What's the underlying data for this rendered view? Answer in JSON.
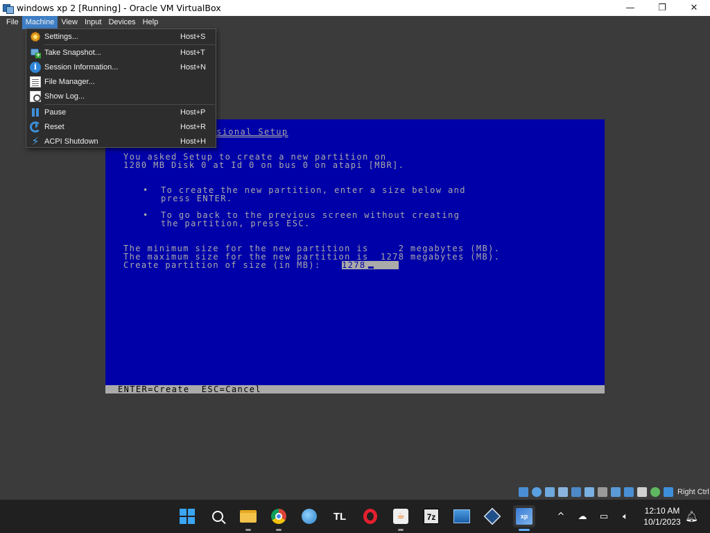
{
  "window": {
    "title": "windows xp 2 [Running] - Oracle VM VirtualBox",
    "minimize": "—",
    "maximize": "❐",
    "close": "✕"
  },
  "menubar": [
    "File",
    "Machine",
    "View",
    "Input",
    "Devices",
    "Help"
  ],
  "machine_menu": [
    {
      "label": "Settings...",
      "shortcut": "Host+S",
      "icon": "gear-icon"
    },
    {
      "label": "Take Snapshot...",
      "shortcut": "Host+T",
      "icon": "snapshot-icon"
    },
    {
      "label": "Session Information...",
      "shortcut": "Host+N",
      "icon": "info-icon"
    },
    {
      "label": "File Manager...",
      "shortcut": "",
      "icon": "file-manager-icon"
    },
    {
      "label": "Show Log...",
      "shortcut": "",
      "icon": "log-icon"
    },
    {
      "label": "Pause",
      "shortcut": "Host+P",
      "icon": "pause-icon"
    },
    {
      "label": "Reset",
      "shortcut": "Host+R",
      "icon": "reset-icon"
    },
    {
      "label": "ACPI Shutdown",
      "shortcut": "Host+H",
      "icon": "shutdown-icon"
    }
  ],
  "setup": {
    "header": "sional Setup",
    "line1": "You asked Setup to create a new partition on",
    "line2": "1280 MB Disk 0 at Id 0 on bus 0 on atapi [MBR].",
    "bullet1a": "To create the new partition, enter a size below and",
    "bullet1b": "press ENTER.",
    "bullet2a": "To go back to the previous screen without creating",
    "bullet2b": "the partition, press ESC.",
    "min_line": "The minimum size for the new partition is     2 megabytes (MB).",
    "max_line": "The maximum size for the new partition is  1278 megabytes (MB).",
    "prompt": "Create partition of size (in MB):",
    "size_value": "1278",
    "status": "ENTER=Create  ESC=Cancel"
  },
  "vbox_status": {
    "host_key": "Right Ctrl",
    "indicator_icons": [
      "hard-disk-icon",
      "optical-icon",
      "floppy-icon",
      "audio-icon",
      "network-icon",
      "usb-icon",
      "shared-folder-icon",
      "display-icon",
      "recording-icon",
      "cpu-icon",
      "mouse-icon",
      "keyboard-icon"
    ]
  },
  "taskbar": {
    "apps": [
      "start",
      "search",
      "file-explorer",
      "chrome",
      "browser",
      "TL",
      "opera",
      "java",
      "7z",
      "remote-desktop",
      "virtualbox",
      "virtualbox-vm"
    ],
    "tl_label": "TL",
    "sevenz_label": "7z",
    "vm_label": "xp",
    "time": "12:10 AM",
    "date": "10/1/2023"
  }
}
